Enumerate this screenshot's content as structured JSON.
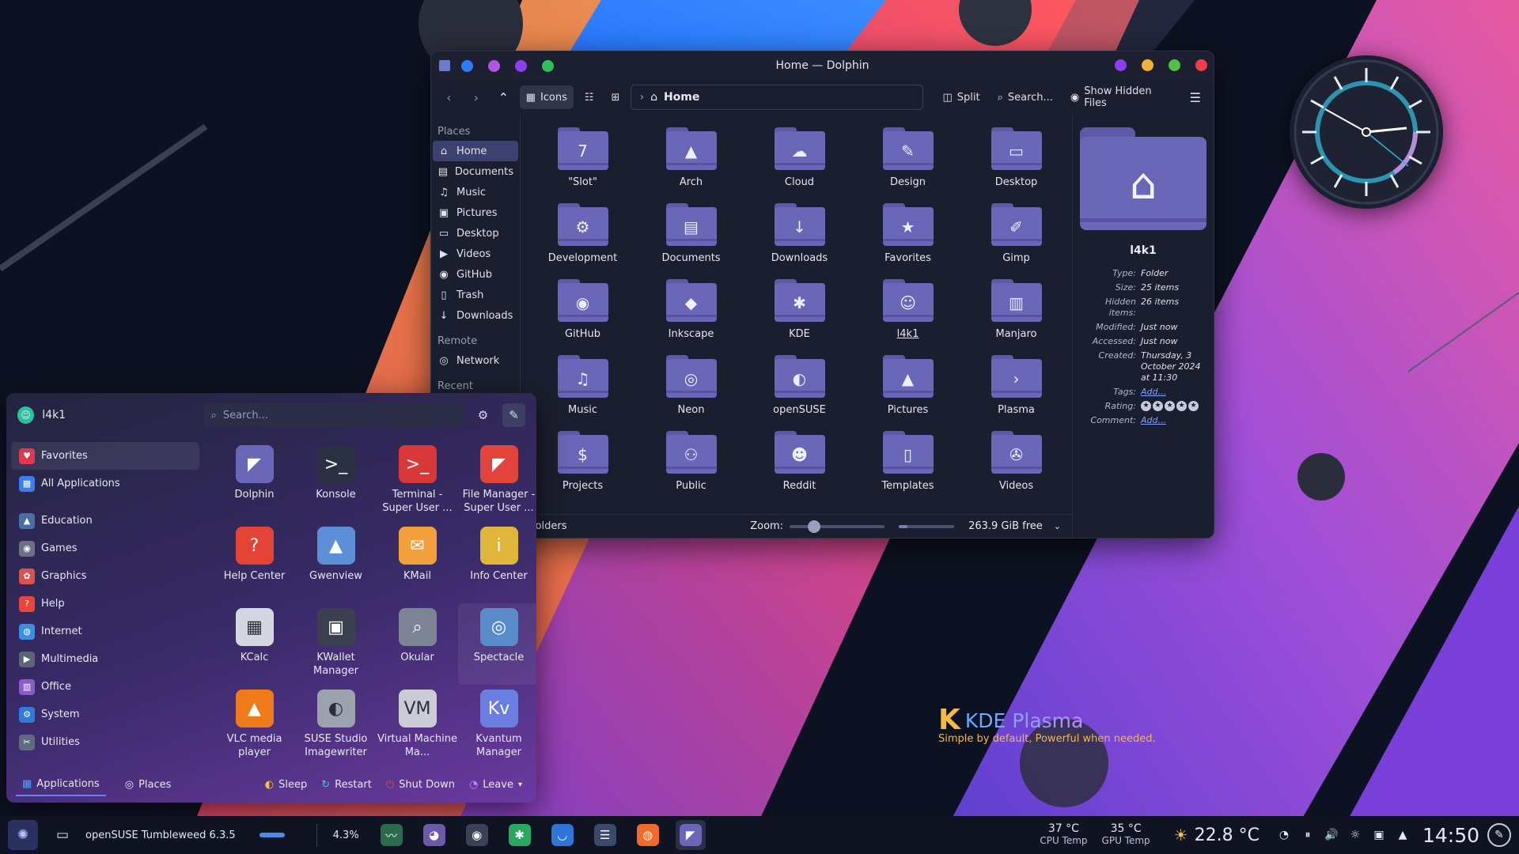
{
  "colors": {
    "accent": "#3b4270",
    "folder": "#6a67b8",
    "panel": "#0f1322",
    "window_bg": "#1b1e2e",
    "title_dots_left": [
      "#2f7dff",
      "#b055e8",
      "#8d3ff0",
      "#2fc25a"
    ],
    "title_dots_right": [
      "#8d3ff0",
      "#f3b233",
      "#4fbf48",
      "#ef3d4a"
    ]
  },
  "dolphin": {
    "title": "Home — Dolphin",
    "toolbar": {
      "view_label": "Icons",
      "location": "Home",
      "split_label": "Split",
      "search_label": "Search...",
      "hidden_files_label": "Show Hidden Files"
    },
    "places": {
      "places_heading": "Places",
      "items": [
        {
          "label": "Home",
          "icon": "home-icon"
        },
        {
          "label": "Documents",
          "icon": "document-icon"
        },
        {
          "label": "Music",
          "icon": "music-icon"
        },
        {
          "label": "Pictures",
          "icon": "picture-icon"
        },
        {
          "label": "Desktop",
          "icon": "desktop-icon"
        },
        {
          "label": "Videos",
          "icon": "video-icon"
        },
        {
          "label": "GitHub",
          "icon": "github-icon"
        },
        {
          "label": "Trash",
          "icon": "trash-icon"
        },
        {
          "label": "Downloads",
          "icon": "download-icon"
        }
      ],
      "remote_heading": "Remote",
      "remote_items": [
        {
          "label": "Network",
          "icon": "network-icon"
        }
      ],
      "recent_heading": "Recent"
    },
    "folders": [
      {
        "label": "\"Slot\"",
        "glyph": "7"
      },
      {
        "label": "Arch",
        "glyph": "▲"
      },
      {
        "label": "Cloud",
        "glyph": "☁"
      },
      {
        "label": "Design",
        "glyph": "✎"
      },
      {
        "label": "Desktop",
        "glyph": "▭"
      },
      {
        "label": "Development",
        "glyph": "⚙"
      },
      {
        "label": "Documents",
        "glyph": "▤"
      },
      {
        "label": "Downloads",
        "glyph": "↓"
      },
      {
        "label": "Favorites",
        "glyph": "★"
      },
      {
        "label": "Gimp",
        "glyph": "✐"
      },
      {
        "label": "GitHub",
        "glyph": "◉"
      },
      {
        "label": "Inkscape",
        "glyph": "◆"
      },
      {
        "label": "KDE",
        "glyph": "✱"
      },
      {
        "label": "l4k1",
        "glyph": "☺"
      },
      {
        "label": "Manjaro",
        "glyph": "▥"
      },
      {
        "label": "Music",
        "glyph": "♫"
      },
      {
        "label": "Neon",
        "glyph": "◎"
      },
      {
        "label": "openSUSE",
        "glyph": "◐"
      },
      {
        "label": "Pictures",
        "glyph": "▲"
      },
      {
        "label": "Plasma",
        "glyph": "›"
      },
      {
        "label": "Projects",
        "glyph": "$"
      },
      {
        "label": "Public",
        "glyph": "⚇"
      },
      {
        "label": "Reddit",
        "glyph": "☻"
      },
      {
        "label": "Templates",
        "glyph": "▯"
      },
      {
        "label": "Videos",
        "glyph": "✇"
      }
    ],
    "status": {
      "text": "folders",
      "zoom_label": "Zoom:",
      "zoom_fraction": 0.22,
      "free_space": "263.9 GiB free",
      "used_fraction": 0.15
    },
    "info": {
      "name": "l4k1",
      "rows": [
        {
          "key": "Type:",
          "value": "Folder"
        },
        {
          "key": "Size:",
          "value": "25 items"
        },
        {
          "key": "Hidden items:",
          "value": "26 items"
        },
        {
          "key": "Modified:",
          "value": "Just now"
        },
        {
          "key": "Accessed:",
          "value": "Just now"
        },
        {
          "key": "Created:",
          "value": "Thursday, 3 October 2024 at 11:30"
        }
      ],
      "tags_key": "Tags:",
      "tags_value": "Add...",
      "rating_key": "Rating:",
      "rating": 0,
      "comment_key": "Comment:",
      "comment_value": "Add..."
    }
  },
  "launcher": {
    "user": "l4k1",
    "search_placeholder": "Search...",
    "categories": [
      {
        "label": "Favorites",
        "icon": "heart-icon",
        "color": "#e0384e",
        "glyph": "♥"
      },
      {
        "label": "All Applications",
        "icon": "grid-icon",
        "color": "#3d7ee8",
        "glyph": "▦"
      },
      {
        "label": "Education",
        "icon": "education-icon",
        "color": "#4a6fa5",
        "glyph": "▲"
      },
      {
        "label": "Games",
        "icon": "gamepad-icon",
        "color": "#6e6f86",
        "glyph": "◉"
      },
      {
        "label": "Graphics",
        "icon": "graphics-icon",
        "color": "#d9534f",
        "glyph": "✿"
      },
      {
        "label": "Help",
        "icon": "help-icon",
        "color": "#e8463c",
        "glyph": "?"
      },
      {
        "label": "Internet",
        "icon": "globe-icon",
        "color": "#3b8fe0",
        "glyph": "◍"
      },
      {
        "label": "Multimedia",
        "icon": "multimedia-icon",
        "color": "#5a6578",
        "glyph": "▶"
      },
      {
        "label": "Office",
        "icon": "office-icon",
        "color": "#8a5cc7",
        "glyph": "▥"
      },
      {
        "label": "System",
        "icon": "system-icon",
        "color": "#2f7bd6",
        "glyph": "⚙"
      },
      {
        "label": "Utilities",
        "icon": "utilities-icon",
        "color": "#5f6c80",
        "glyph": "✂"
      }
    ],
    "apps": [
      {
        "label": "Dolphin",
        "icon": "dolphin-icon",
        "color": "#6a67b8",
        "glyph": "◤"
      },
      {
        "label": "Konsole",
        "icon": "konsole-icon",
        "color": "#2b3142",
        "glyph": ">_"
      },
      {
        "label": "Terminal - Super User ...",
        "icon": "terminal-root-icon",
        "color": "#d9383a",
        "glyph": ">_"
      },
      {
        "label": "File Manager - Super User ...",
        "icon": "file-manager-root-icon",
        "color": "#e2443c",
        "glyph": "◤"
      },
      {
        "label": "Help Center",
        "icon": "help-center-icon",
        "color": "#e34436",
        "glyph": "?"
      },
      {
        "label": "Gwenview",
        "icon": "gwenview-icon",
        "color": "#5c8fd8",
        "glyph": "▲"
      },
      {
        "label": "KMail",
        "icon": "kmail-icon",
        "color": "#f2a13a",
        "glyph": "✉"
      },
      {
        "label": "Info Center",
        "icon": "info-center-icon",
        "color": "#e0b63a",
        "glyph": "i"
      },
      {
        "label": "KCalc",
        "icon": "kcalc-icon",
        "color": "#d4d7e0",
        "glyph": "▦"
      },
      {
        "label": "KWallet Manager",
        "icon": "kwallet-icon",
        "color": "#3a4050",
        "glyph": "▣"
      },
      {
        "label": "Okular",
        "icon": "okular-icon",
        "color": "#7b8394",
        "glyph": "⌕"
      },
      {
        "label": "Spectacle",
        "icon": "spectacle-icon",
        "color": "#5a8ccc",
        "glyph": "◎"
      },
      {
        "label": "VLC media player",
        "icon": "vlc-icon",
        "color": "#f07a1a",
        "glyph": "▲"
      },
      {
        "label": "SUSE Studio Imagewriter",
        "icon": "imagewriter-icon",
        "color": "#9aa2ae",
        "glyph": "◐"
      },
      {
        "label": "Virtual Machine Ma...",
        "icon": "virt-manager-icon",
        "color": "#c9ccd4",
        "glyph": "VM"
      },
      {
        "label": "Kvantum Manager",
        "icon": "kvantum-icon",
        "color": "#6a7de0",
        "glyph": "Kv"
      }
    ],
    "footer": {
      "applications_tab": "Applications",
      "places_tab": "Places",
      "sleep": "Sleep",
      "restart": "Restart",
      "shutdown": "Shut Down",
      "leave": "Leave"
    }
  },
  "panel": {
    "task_title": "openSUSE Tumbleweed 6.3.5",
    "cpu_usage": "4.3%",
    "cpu_temp": "37 °C",
    "cpu_temp_label": "CPU Temp",
    "gpu_temp": "35 °C",
    "gpu_temp_label": "GPU Temp",
    "weather": "22.8 °C",
    "clock": "14:50",
    "task_apps": [
      {
        "icon": "system-monitor-icon",
        "color": "#2b6a4a"
      },
      {
        "icon": "pidgin-icon",
        "color": "#6a5aa8"
      },
      {
        "icon": "steam-icon",
        "color": "#3a4256"
      },
      {
        "icon": "mastodon-icon",
        "color": "#2aa860"
      },
      {
        "icon": "discover-icon",
        "color": "#2f74d8"
      },
      {
        "icon": "settings-icon",
        "color": "#3a4a6a"
      },
      {
        "icon": "firefox-icon",
        "color": "#f06a2a"
      },
      {
        "icon": "dolphin-taskbar-icon",
        "color": "#6a67b8"
      }
    ]
  },
  "branding": {
    "logo_text": "KDE Plasma",
    "tagline": "Simple by default, Powerful when needed."
  }
}
